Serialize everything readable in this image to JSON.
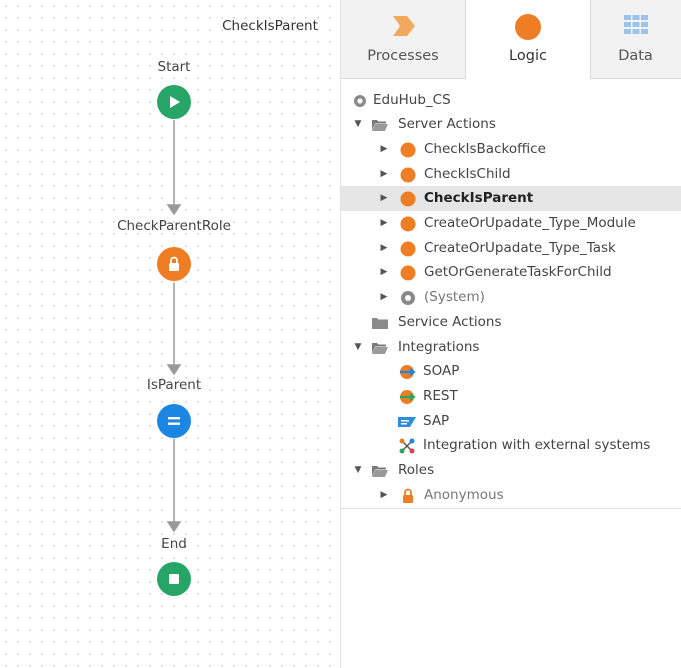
{
  "canvas": {
    "title": "CheckIsParent",
    "nodes": [
      {
        "label": "Start",
        "type": "start"
      },
      {
        "label": "CheckParentRole",
        "type": "check-role"
      },
      {
        "label": "IsParent",
        "type": "assign"
      },
      {
        "label": "End",
        "type": "end"
      }
    ]
  },
  "tabs": [
    {
      "label": "Processes",
      "icon": "processes-icon"
    },
    {
      "label": "Logic",
      "icon": "logic-icon",
      "active": true
    },
    {
      "label": "Data",
      "icon": "data-grid-icon"
    }
  ],
  "colors": {
    "green": "#27a567",
    "orange": "#ef7d24",
    "blue": "#1c86e3",
    "selected_row": "#e6e6e6"
  },
  "tree": {
    "module": "EduHub_CS",
    "server_actions": {
      "label": "Server Actions",
      "items": [
        "CheckIsBackoffice",
        "CheckIsChild",
        "CheckIsParent",
        "CreateOrUpadate_Type_Module",
        "CreateOrUpadate_Type_Task",
        "GetOrGenerateTaskForChild"
      ],
      "system": "(System)"
    },
    "service_actions": "Service Actions",
    "integrations": {
      "label": "Integrations",
      "items": [
        "SOAP",
        "REST",
        "SAP",
        "Integration with external systems"
      ]
    },
    "roles": {
      "label": "Roles",
      "items": [
        "Anonymous"
      ]
    }
  }
}
